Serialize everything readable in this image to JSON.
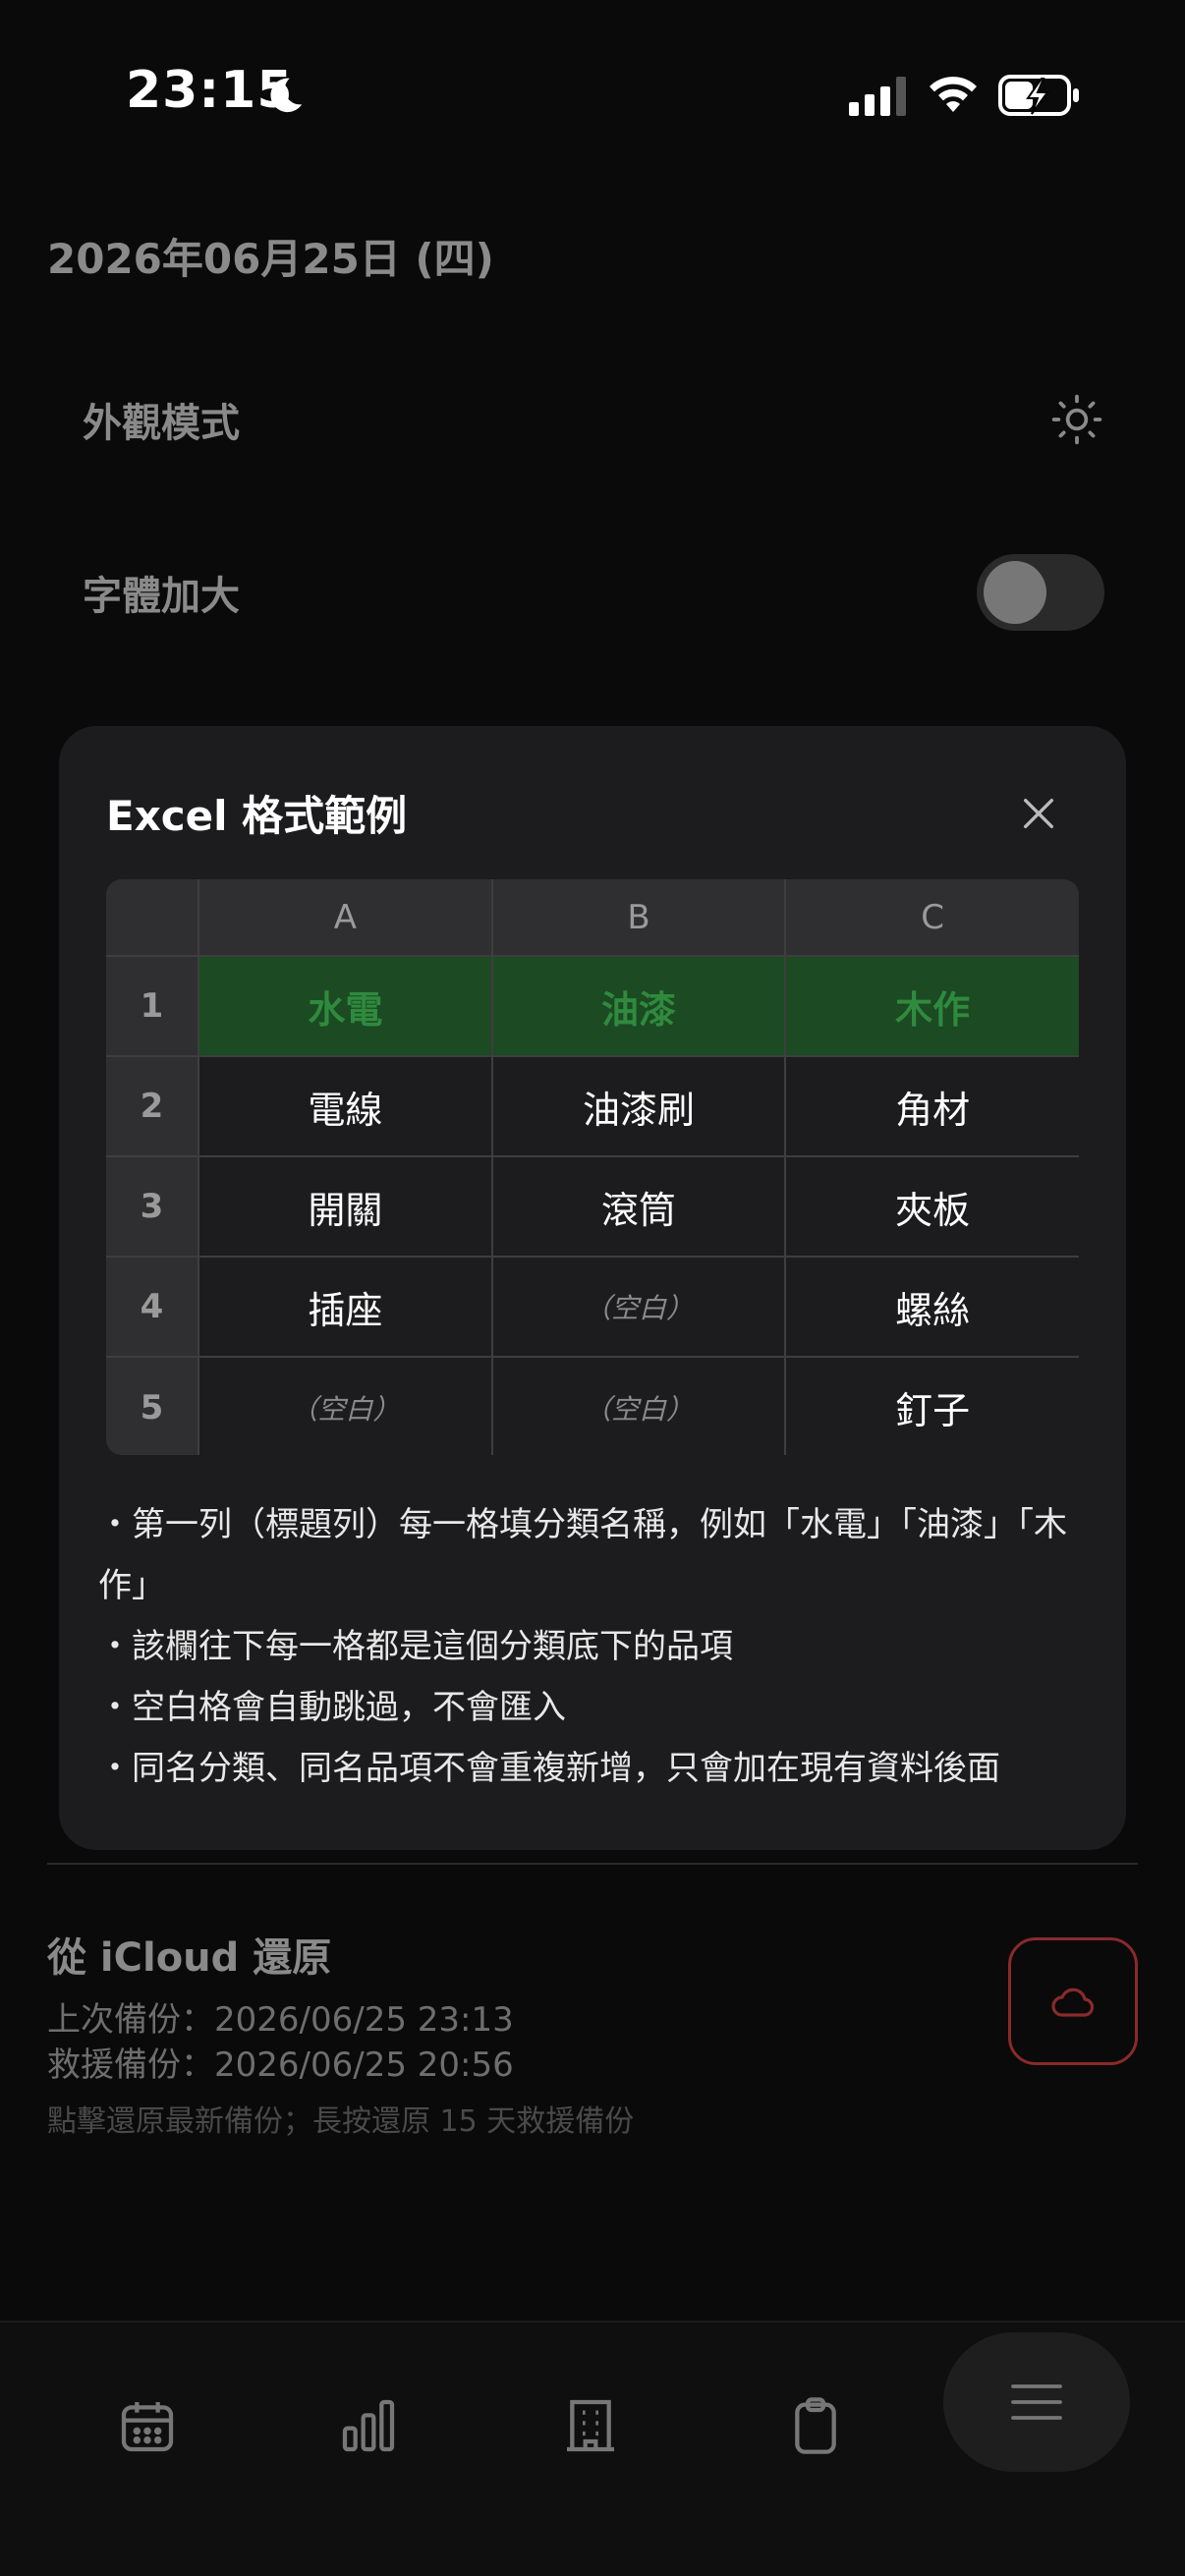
{
  "status_bar": {
    "time": "23:15"
  },
  "page": {
    "date_title": "2026年06月25日 (四)",
    "settings": {
      "appearance_label": "外觀模式",
      "font_label": "字體加大"
    },
    "icloud": {
      "title": "從 iCloud 還原",
      "last_backup": "上次備份：2026/06/25 23:13",
      "rescue_backup": "救援備份：2026/06/25 20:56",
      "hint": "點擊還原最新備份；長按還原 15 天救援備份"
    }
  },
  "modal": {
    "title": "Excel 格式範例",
    "sheet": {
      "columns": [
        "A",
        "B",
        "C"
      ],
      "rows": [
        {
          "num": "1",
          "cells": [
            "水電",
            "油漆",
            "木作"
          ]
        },
        {
          "num": "2",
          "cells": [
            "電線",
            "油漆刷",
            "角材"
          ]
        },
        {
          "num": "3",
          "cells": [
            "開關",
            "滾筒",
            "夾板"
          ]
        },
        {
          "num": "4",
          "cells": [
            "插座",
            "（空白）",
            "螺絲"
          ]
        },
        {
          "num": "5",
          "cells": [
            "（空白）",
            "（空白）",
            "釘子"
          ]
        }
      ]
    },
    "notes": [
      "・第一列（標題列）每一格填分類名稱，例如「水電」「油漆」「木作」",
      "・該欄往下每一格都是這個分類底下的品項",
      "・空白格會自動跳過，不會匯入",
      "・同名分類、同名品項不會重複新增，只會加在現有資料後面"
    ]
  },
  "colors": {
    "background": "#0a0a0a",
    "modal": "#1c1c1e",
    "header_row_bg": "#1c4a22",
    "header_row_text": "#2f8a3e",
    "cloud_button_border": "#8a2a2a"
  },
  "icons": {
    "status": [
      "moon-icon",
      "signal-icon",
      "wifi-icon",
      "battery-charging-icon"
    ],
    "tabs": [
      "calendar-icon",
      "bar-chart-icon",
      "building-icon",
      "clipboard-icon",
      "menu-icon"
    ]
  }
}
